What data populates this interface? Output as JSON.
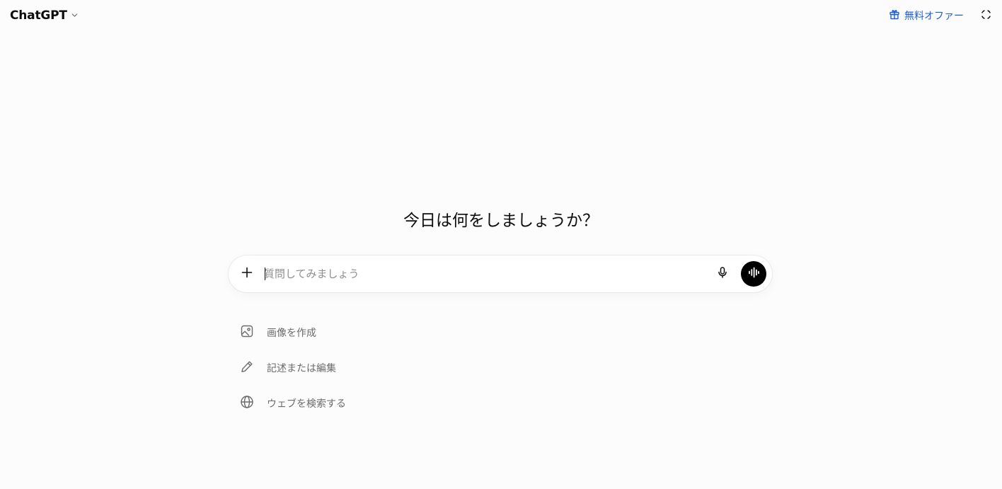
{
  "header": {
    "model_name": "ChatGPT",
    "offer_label": "無料オファー"
  },
  "main": {
    "greeting": "今日は何をしましょうか？"
  },
  "composer": {
    "placeholder": "質問してみましょう",
    "value": ""
  },
  "suggestions": [
    {
      "label": "画像を作成",
      "icon": "image-icon"
    },
    {
      "label": "記述または編集",
      "icon": "pencil-icon"
    },
    {
      "label": "ウェブを検索する",
      "icon": "globe-icon"
    }
  ],
  "colors": {
    "background": "#fcfcfc",
    "accent_link": "#1f5fd6",
    "voice_button": "#000000",
    "muted_text": "#6b6b6b"
  }
}
